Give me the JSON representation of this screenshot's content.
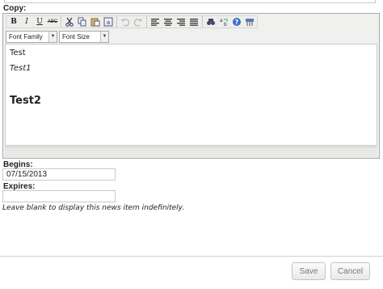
{
  "labels": {
    "copy": "Copy:",
    "begins": "Begins:",
    "expires": "Expires:"
  },
  "editor": {
    "toolbar": {
      "font_family": "Font Family",
      "font_size": "Font Size"
    },
    "content": {
      "line1": "Test",
      "line2": "Test1",
      "line3": "Test2"
    }
  },
  "fields": {
    "begins_value": "07/15/2013",
    "expires_value": ""
  },
  "hint": "Leave blank to display this news item indefinitely.",
  "buttons": {
    "save": "Save",
    "cancel": "Cancel"
  },
  "icons": [
    "bold-icon",
    "italic-icon",
    "underline-icon",
    "strikethrough-icon",
    "cut-icon",
    "copy-icon",
    "paste-icon",
    "paste-text-icon",
    "undo-icon",
    "redo-icon",
    "align-left-icon",
    "align-center-icon",
    "align-right-icon",
    "justify-icon",
    "find-icon",
    "replace-icon",
    "help-icon",
    "cleanup-icon"
  ]
}
